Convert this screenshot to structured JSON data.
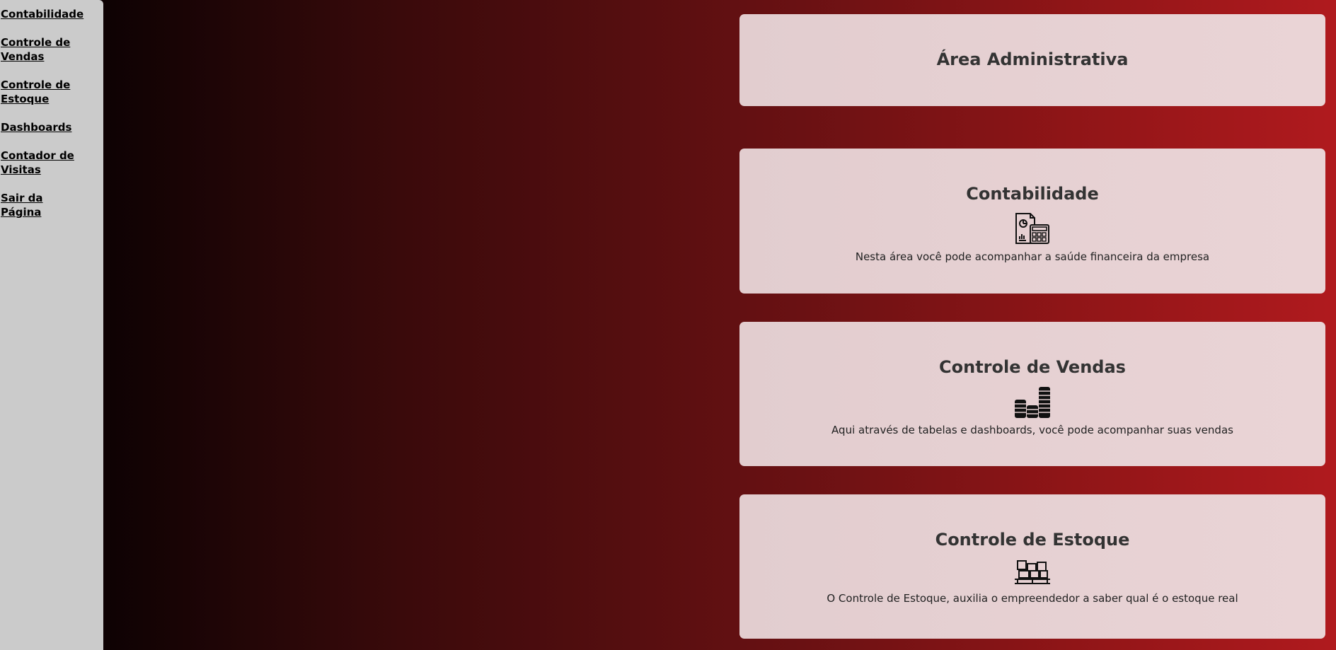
{
  "sidebar": {
    "items": [
      {
        "label": "Contabilidade"
      },
      {
        "label": "Controle de Vendas"
      },
      {
        "label": "Controle de Estoque"
      },
      {
        "label": "Dashboards"
      },
      {
        "label": "Contador de Visitas"
      },
      {
        "label": "Sair da Página"
      }
    ]
  },
  "header_card": {
    "title": "Área Administrativa"
  },
  "cards": [
    {
      "title": "Contabilidade",
      "icon": "accounting-report-icon",
      "description": "Nesta área você pode acompanhar a saúde financeira da empresa"
    },
    {
      "title": "Controle de Vendas",
      "icon": "coin-stacks-icon",
      "description": "Aqui através de tabelas e dashboards, você pode acompanhar suas vendas"
    },
    {
      "title": "Controle de Estoque",
      "icon": "inventory-pallet-icon",
      "description": "O Controle de Estoque, auxilia o empreendedor a saber qual é o estoque real"
    }
  ],
  "colors": {
    "sidebar_bg": "#cbcbcb",
    "card_bg": "#e6d1d3",
    "gradient_start": "#0e0203",
    "gradient_end": "#b01a1e"
  }
}
